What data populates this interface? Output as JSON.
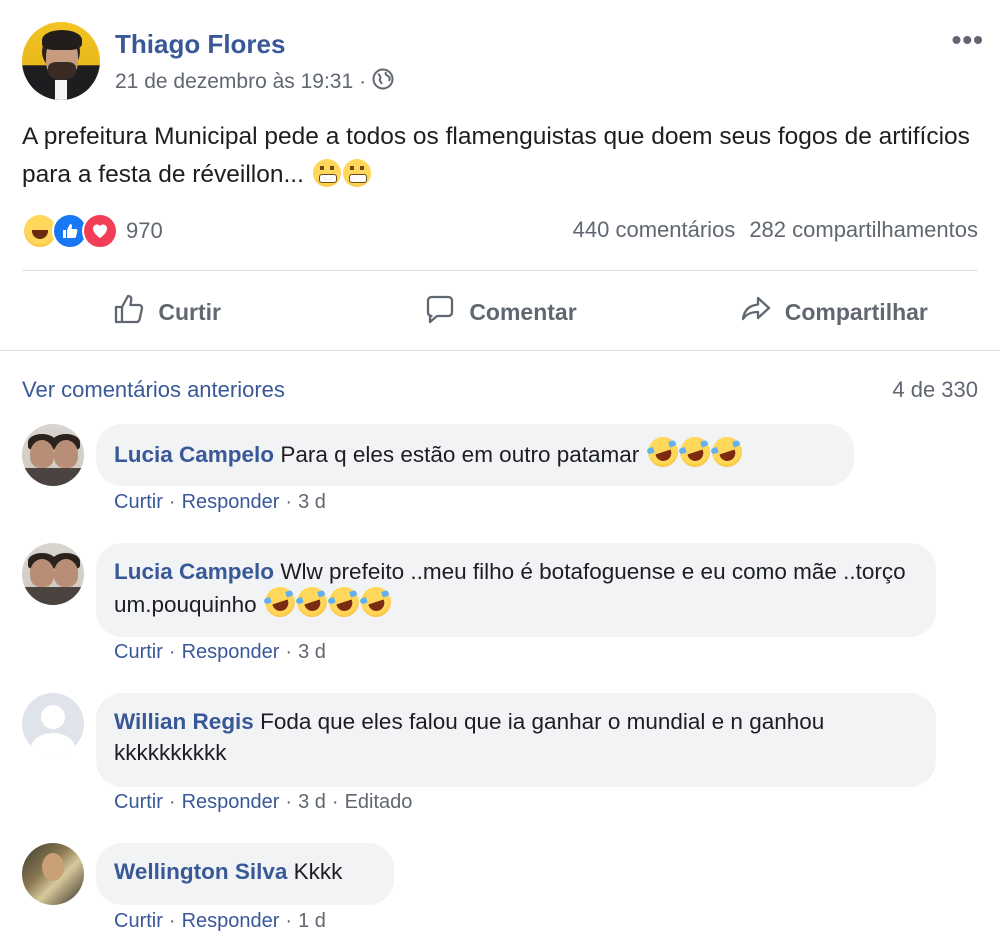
{
  "post": {
    "author": "Thiago Flores",
    "timestamp": "21 de dezembro às 19:31",
    "separator": "·",
    "privacy_icon": "globe-icon",
    "more_label": "•••",
    "text": "A prefeitura Municipal pede a todos os flamenguistas que doem seus fogos de artifícios para a festa de réveillon...",
    "text_emojis": [
      "grimacing-face",
      "grimacing-face"
    ]
  },
  "reactions": {
    "icons": [
      "haha-icon",
      "like-icon",
      "love-icon"
    ],
    "count": "970",
    "comments": "440 comentários",
    "shares": "282 compartilhamentos"
  },
  "actions": {
    "like": "Curtir",
    "comment": "Comentar",
    "share": "Compartilhar"
  },
  "comments_header": {
    "previous": "Ver comentários anteriores",
    "count": "4 de 330"
  },
  "comments": [
    {
      "name": "Lucia Campelo",
      "text": "Para q eles estão em outro patamar",
      "emojis": 3,
      "like": "Curtir",
      "reply": "Responder",
      "age": "3 d"
    },
    {
      "name": "Lucia Campelo",
      "text": "Wlw prefeito ..meu filho é botafoguense e eu como mãe ..torço um.pouquinho",
      "emojis": 4,
      "like": "Curtir",
      "reply": "Responder",
      "age": "3 d"
    },
    {
      "name": "Willian Regis",
      "text": "Foda que eles falou que ia ganhar o mundial e n ganhou kkkkkkkkkk",
      "like": "Curtir",
      "reply": "Responder",
      "age": "3 d",
      "edited": "Editado"
    },
    {
      "name": "Wellington Silva",
      "text": "Kkkk",
      "like": "Curtir",
      "reply": "Responder",
      "age": "1 d"
    }
  ],
  "colors": {
    "link": "#385898",
    "secondary_text": "#606770",
    "bubble": "#f2f3f5",
    "like_blue": "#1877f2",
    "love_red": "#f33e58"
  }
}
